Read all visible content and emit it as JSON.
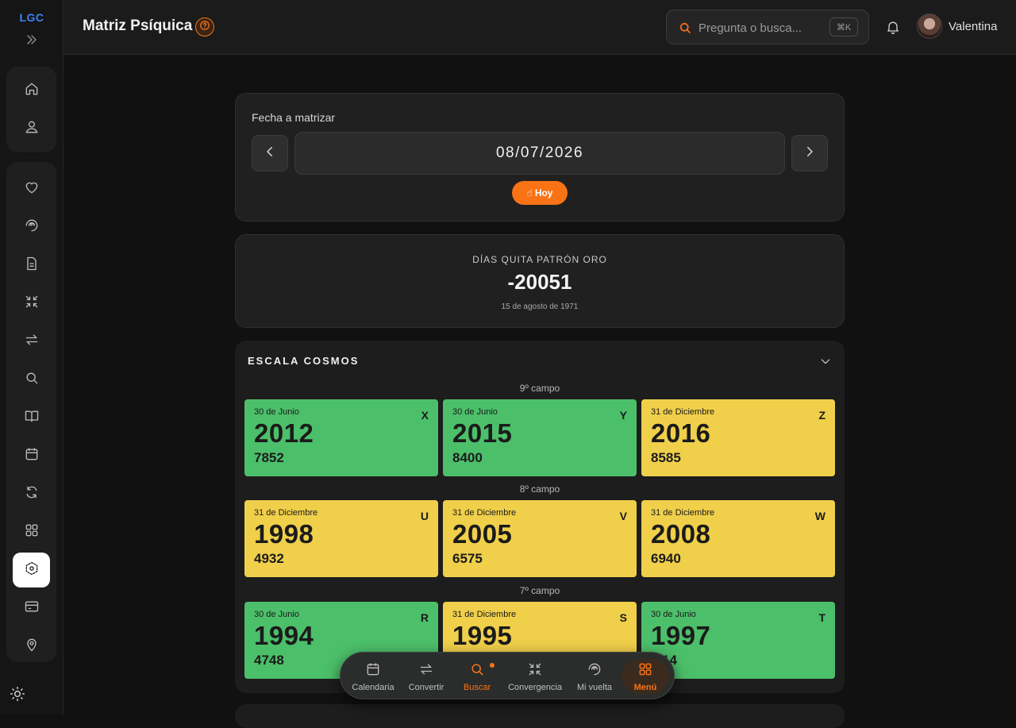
{
  "sidebar": {
    "logo": "LGC",
    "items": [
      {
        "icon": "home-icon"
      },
      {
        "icon": "user-icon"
      },
      {
        "icon": "heart-icon"
      },
      {
        "icon": "spiral-icon"
      },
      {
        "icon": "document-icon"
      },
      {
        "icon": "converge-icon"
      },
      {
        "icon": "arrows-swap-icon"
      },
      {
        "icon": "search-icon"
      },
      {
        "icon": "book-icon"
      },
      {
        "icon": "calendar-icon"
      },
      {
        "icon": "refresh-icon"
      },
      {
        "icon": "grid-icon"
      },
      {
        "icon": "matrix-icon",
        "active": true
      },
      {
        "icon": "card-icon"
      },
      {
        "icon": "map-pin-icon"
      }
    ]
  },
  "header": {
    "title": "Matriz Psíquica",
    "search_placeholder": "Pregunta o busca...",
    "shortcut": "⌘K",
    "user": "Valentina"
  },
  "date_card": {
    "label": "Fecha a matrizar",
    "date": "08/07/2026",
    "today_button": "Hoy",
    "today_icon": "☝"
  },
  "dias_card": {
    "label": "DÍAS QUITA PATRÓN ORO",
    "value": "-20051",
    "date": "15 de agosto de 1971"
  },
  "cosmos": {
    "title": "ESCALA COSMOS",
    "fields": [
      {
        "name": "9º campo",
        "tiles": [
          {
            "date": "30 de Junio",
            "letter": "X",
            "year": "2012",
            "number": "7852",
            "color": "green"
          },
          {
            "date": "30 de Junio",
            "letter": "Y",
            "year": "2015",
            "number": "8400",
            "color": "green"
          },
          {
            "date": "31 de Diciembre",
            "letter": "Z",
            "year": "2016",
            "number": "8585",
            "color": "yellow"
          }
        ]
      },
      {
        "name": "8º campo",
        "tiles": [
          {
            "date": "31 de Diciembre",
            "letter": "U",
            "year": "1998",
            "number": "4932",
            "color": "yellow"
          },
          {
            "date": "31 de Diciembre",
            "letter": "V",
            "year": "2005",
            "number": "6575",
            "color": "yellow"
          },
          {
            "date": "31 de Diciembre",
            "letter": "W",
            "year": "2008",
            "number": "6940",
            "color": "yellow"
          }
        ]
      },
      {
        "name": "7º campo",
        "tiles": [
          {
            "date": "30 de Junio",
            "letter": "R",
            "year": "1994",
            "number": "4748",
            "color": "green"
          },
          {
            "date": "31 de Diciembre",
            "letter": "S",
            "year": "1995",
            "number": "",
            "color": "yellow"
          },
          {
            "date": "30 de Junio",
            "letter": "T",
            "year": "1997",
            "number": "14",
            "color": "green"
          }
        ]
      }
    ]
  },
  "bottom_nav": [
    {
      "label": "Calendaria",
      "icon": "calendar-icon"
    },
    {
      "label": "Convertir",
      "icon": "arrows-swap-icon"
    },
    {
      "label": "Buscar",
      "icon": "search-icon",
      "notification": true
    },
    {
      "label": "Convergencia",
      "icon": "converge-icon"
    },
    {
      "label": "Mi vuelta",
      "icon": "spiral-icon"
    },
    {
      "label": "Menú",
      "icon": "grid-icon",
      "active": true
    }
  ],
  "colors": {
    "accent": "#f97316",
    "green_tile": "#4cbf6a",
    "yellow_tile": "#f0cf4a",
    "logo": "#3b82f6"
  }
}
